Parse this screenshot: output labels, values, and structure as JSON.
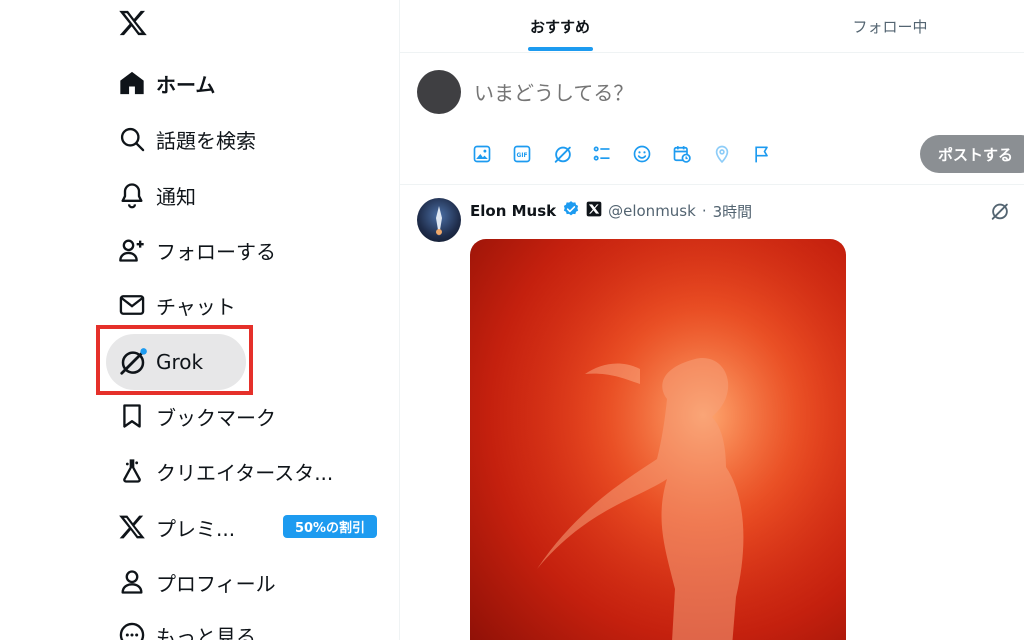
{
  "sidebar": {
    "logo": "x-logo-icon",
    "items": [
      {
        "label": "ホーム",
        "icon": "home-icon",
        "active": true
      },
      {
        "label": "話題を検索",
        "icon": "search-icon"
      },
      {
        "label": "通知",
        "icon": "bell-icon"
      },
      {
        "label": "フォローする",
        "icon": "follow-icon"
      },
      {
        "label": "チャット",
        "icon": "envelope-icon"
      },
      {
        "label": "Grok",
        "icon": "grok-icon"
      },
      {
        "label": "ブックマーク",
        "icon": "bookmark-icon"
      },
      {
        "label": "クリエイタースタ...",
        "icon": "creator-studio-icon"
      },
      {
        "label": "プレミ...",
        "icon": "x-premium-icon"
      },
      {
        "label": "プロフィール",
        "icon": "person-icon"
      },
      {
        "label": "もっと見る",
        "icon": "more-icon"
      }
    ],
    "premium_badge": "50%の割引"
  },
  "tabs": [
    {
      "label": "おすすめ",
      "active": true
    },
    {
      "label": "フォロー中",
      "active": false
    }
  ],
  "composer": {
    "placeholder": "いまどうしてる？",
    "post_button": "ポストする",
    "tools": [
      "image-icon",
      "gif-icon",
      "grok-icon",
      "poll-icon",
      "emoji-icon",
      "schedule-icon",
      "location-icon",
      "flag-icon"
    ]
  },
  "tweet": {
    "author_name": "Elon Musk",
    "handle": "@elonmusk",
    "time": "3時間",
    "verified": true
  },
  "colors": {
    "accent": "#1d9bf0",
    "highlight": "#e5302a",
    "text": "#0f1419",
    "muted": "#536471"
  }
}
